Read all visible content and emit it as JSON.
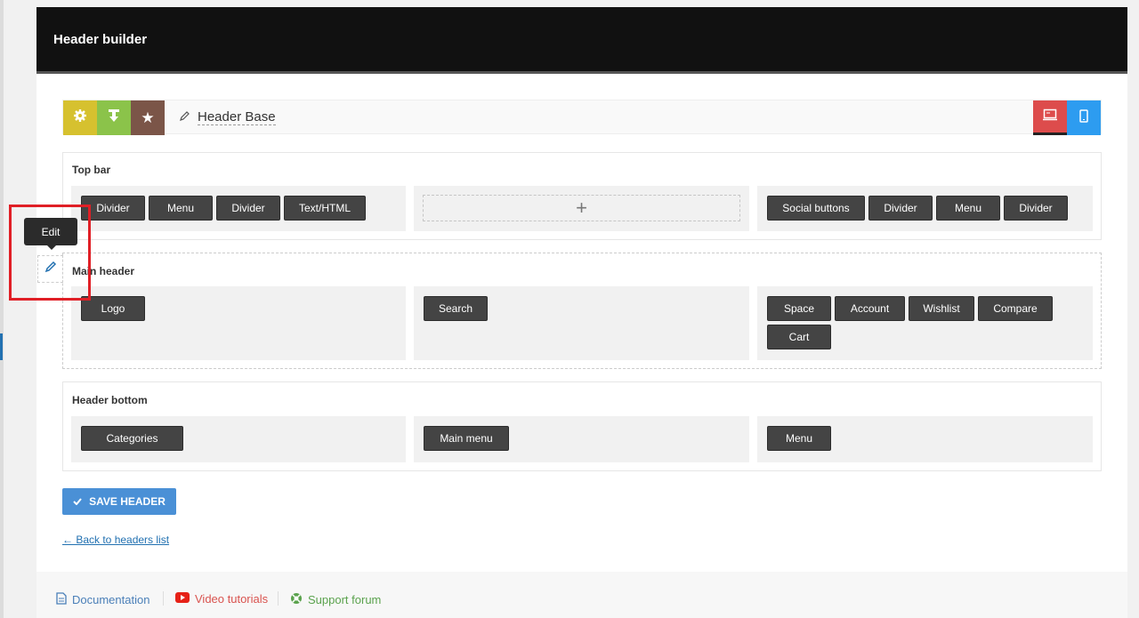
{
  "page_title": "Header builder",
  "toolbar": {
    "header_name": "Header Base",
    "icons": [
      "gear-icon",
      "import-icon",
      "star-icon",
      "desktop-icon",
      "mobile-icon"
    ],
    "colors": {
      "gear": "#d6c12f",
      "import": "#8bc34a",
      "star": "#7b5548",
      "desktop": "#dd4c4c",
      "mobile": "#2d9cf0"
    }
  },
  "rows": {
    "top_bar": {
      "title": "Top bar",
      "left": [
        "Divider",
        "Menu",
        "Divider",
        "Text/HTML"
      ],
      "center_add": "+",
      "right": [
        "Social buttons",
        "Divider",
        "Menu",
        "Divider"
      ]
    },
    "main_header": {
      "title": "Main header",
      "left": [
        "Logo"
      ],
      "center": [
        "Search"
      ],
      "right": [
        "Space",
        "Account",
        "Wishlist",
        "Compare",
        "Cart"
      ]
    },
    "header_bottom": {
      "title": "Header bottom",
      "left": [
        "Categories"
      ],
      "center": [
        "Main menu"
      ],
      "right": [
        "Menu"
      ]
    }
  },
  "tooltip": "Edit",
  "save_label": "SAVE HEADER",
  "back_link": "← Back to headers list",
  "footer": {
    "documentation": "Documentation",
    "video": "Video tutorials",
    "support": "Support forum"
  }
}
